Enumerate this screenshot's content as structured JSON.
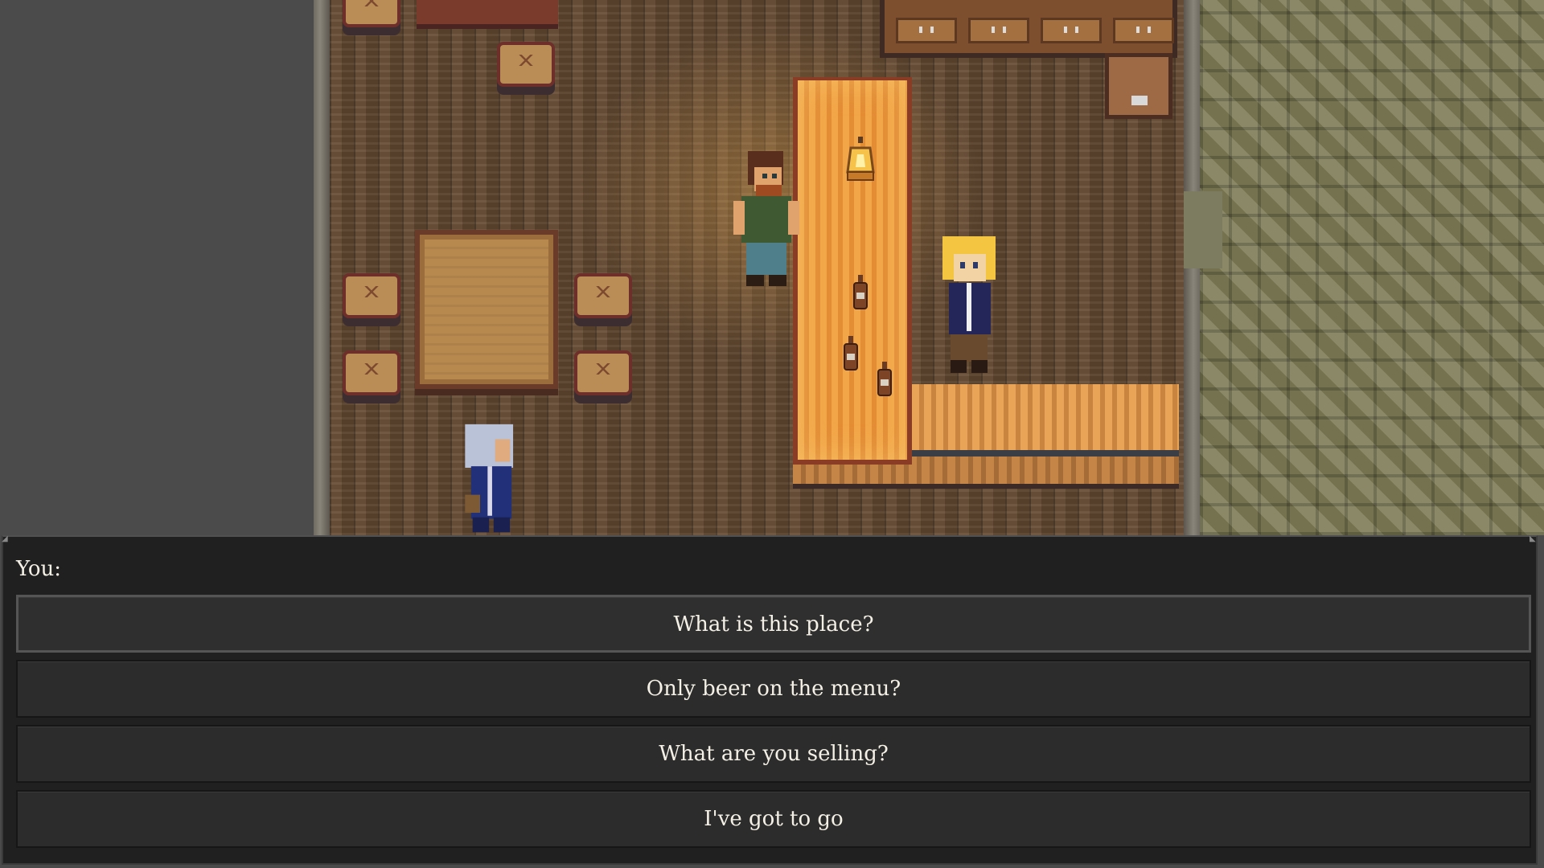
{
  "dialogue": {
    "speaker": "You:",
    "options": [
      {
        "label": "What is this place?",
        "selected": true
      },
      {
        "label": "Only beer on the menu?",
        "selected": false
      },
      {
        "label": "What are you selling?",
        "selected": false
      },
      {
        "label": "I've got to go",
        "selected": false
      }
    ]
  },
  "colors": {
    "panel_background": "#202020",
    "option_background": "#2c2c2c",
    "option_text": "#f4f0e6",
    "floor": "#5e4631",
    "bar_counter": "#f2a648",
    "outside_tiles": "#7c7a5e"
  },
  "scene": {
    "characters": [
      "bartender",
      "blonde-patron",
      "silver-haired-player"
    ],
    "icons": [
      "oil-lamp-icon",
      "bottle-icon"
    ]
  }
}
